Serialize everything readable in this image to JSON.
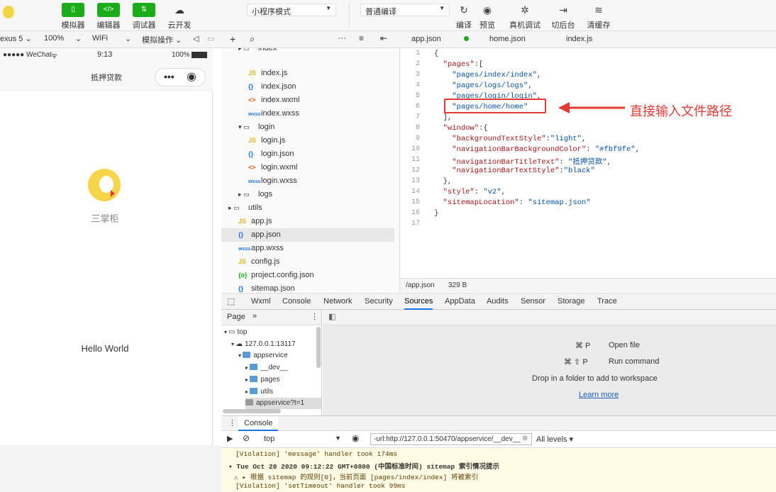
{
  "toolbar": {
    "buttons": [
      {
        "label": "模拟器",
        "glyph": "▯"
      },
      {
        "label": "编辑器",
        "glyph": "</>"
      },
      {
        "label": "调试器",
        "glyph": "⇅"
      },
      {
        "label": "云开发",
        "glyph": "☁"
      }
    ],
    "mode_select": "小程序模式",
    "compile_select": "普通编译",
    "right_buttons": [
      {
        "label": "编译",
        "icon": "refresh-icon",
        "glyph": "↻"
      },
      {
        "label": "预览",
        "icon": "eye-icon",
        "glyph": "◉"
      },
      {
        "label": "真机调试",
        "icon": "bug-icon",
        "glyph": "✲"
      },
      {
        "label": "切后台",
        "icon": "switch-icon",
        "glyph": "⇥"
      },
      {
        "label": "清缓存",
        "icon": "layers-icon",
        "glyph": "≋"
      }
    ]
  },
  "simulator_bar": {
    "device": "exus 5",
    "zoom": "100%",
    "network": "WiFi",
    "action": "模拟操作"
  },
  "phone": {
    "carrier": "●●●●● WeChat",
    "time": "9:13",
    "battery": "100%",
    "nav_title": "抵押贷款",
    "logo_caption": "三掌柜",
    "hello": "Hello World"
  },
  "file_tree": {
    "items": [
      {
        "name": "index",
        "icon": "folder",
        "indent": 1
      },
      {
        "name": "index.js",
        "icon": "JS",
        "indent": 2
      },
      {
        "name": "index.json",
        "icon": "{}",
        "indent": 2
      },
      {
        "name": "index.wxml",
        "icon": "<>",
        "indent": 2
      },
      {
        "name": "index.wxss",
        "icon": "wxss",
        "indent": 2
      },
      {
        "name": "login",
        "icon": "folder-open",
        "indent": 1
      },
      {
        "name": "login.js",
        "icon": "JS",
        "indent": 2
      },
      {
        "name": "login.json",
        "icon": "{}",
        "indent": 2
      },
      {
        "name": "login.wxml",
        "icon": "<>",
        "indent": 2
      },
      {
        "name": "login.wxss",
        "icon": "wxss",
        "indent": 2
      },
      {
        "name": "logs",
        "icon": "folder",
        "indent": 1
      },
      {
        "name": "utils",
        "icon": "folder",
        "indent": 0
      },
      {
        "name": "app.js",
        "icon": "JS",
        "indent": 1
      },
      {
        "name": "app.json",
        "icon": "{}",
        "indent": 1,
        "selected": true
      },
      {
        "name": "app.wxss",
        "icon": "wxss",
        "indent": 1
      },
      {
        "name": "config.js",
        "icon": "JS",
        "indent": 1
      },
      {
        "name": "project.config.json",
        "icon": "{o}",
        "indent": 1
      },
      {
        "name": "sitemap.json",
        "icon": "{}",
        "indent": 1
      }
    ]
  },
  "editor": {
    "tabs": [
      "app.json",
      "home.json",
      "index.js"
    ],
    "lines": [
      "{",
      "  \"pages\":[",
      "    \"pages/index/index\",",
      "    \"pages/logs/logs\",",
      "    \"pages/login/login\",",
      "    \"pages/home/home\"",
      "  ],",
      "  \"window\":{",
      "    \"backgroundTextStyle\":\"light\",",
      "    \"navigationBarBackgroundColor\": \"#fbf9fe\",",
      "    \"navigationBarTitleText\": \"抵押贷款\",",
      "    \"navigationBarTextStyle\":\"black\"",
      "  },",
      "  \"style\": \"v2\",",
      "  \"sitemapLocation\": \"sitemap.json\"",
      "}",
      ""
    ],
    "annotation": "直接输入文件路径",
    "status_path": "/app.json",
    "status_size": "329 B"
  },
  "devtools": {
    "tabs": [
      "Wxml",
      "Console",
      "Network",
      "Security",
      "Sources",
      "AppData",
      "Audits",
      "Sensor",
      "Storage",
      "Trace"
    ],
    "active_tab": "Sources",
    "page_label": "Page",
    "tree": [
      {
        "name": "top",
        "indent": 0,
        "kind": "frame"
      },
      {
        "name": "127.0.0.1:13117",
        "indent": 1,
        "kind": "cloud"
      },
      {
        "name": "appservice",
        "indent": 2,
        "kind": "folder"
      },
      {
        "name": "__dev__",
        "indent": 3,
        "kind": "folder"
      },
      {
        "name": "pages",
        "indent": 3,
        "kind": "folder"
      },
      {
        "name": "utils",
        "indent": 3,
        "kind": "folder"
      },
      {
        "name": "appservice?t=1",
        "indent": 3,
        "kind": "file"
      }
    ],
    "shortcuts": [
      {
        "keys": "⌘ P",
        "label": "Open file"
      },
      {
        "keys": "⌘ ⇧ P",
        "label": "Run command"
      }
    ],
    "drop_hint": "Drop in a folder to add to workspace",
    "learn_more": "Learn more"
  },
  "console": {
    "tab": "Console",
    "context": "top",
    "filter": "-url:http://127.0.0.1:50470/appservice/__dev__",
    "levels": "All levels ▾",
    "messages": [
      "[Violation] 'message' handler took 174ms",
      "▾ Tue Oct 20 2020 09:12:22 GMT+0800 (中国标准时间) sitemap 索引情况提示",
      "⚠ ▸ 根据 sitemap 的规则[0]，当前页面 [pages/index/index] 将被索引",
      "[Violation] 'setTimeout' handler took 99ms"
    ]
  }
}
